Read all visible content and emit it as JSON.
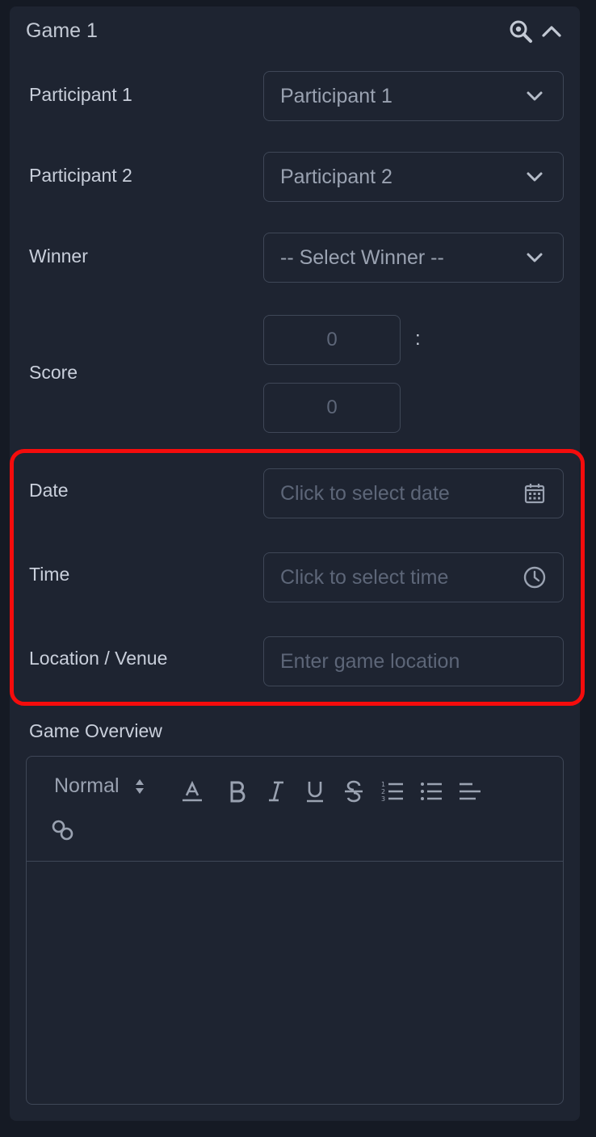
{
  "game": {
    "title": "Game 1",
    "header_icons": [
      "zoom-in-icon",
      "chevron-up-icon"
    ]
  },
  "fields": {
    "participant1": {
      "label": "Participant 1",
      "value": "Participant 1"
    },
    "participant2": {
      "label": "Participant 2",
      "value": "Participant 2"
    },
    "winner": {
      "label": "Winner",
      "value": "-- Select Winner --"
    },
    "score": {
      "label": "Score",
      "value1": "0",
      "value2": "0",
      "separator": ":"
    },
    "date": {
      "label": "Date",
      "placeholder": "Click to select date"
    },
    "time": {
      "label": "Time",
      "placeholder": "Click to select time"
    },
    "location": {
      "label": "Location / Venue",
      "placeholder": "Enter game location"
    }
  },
  "overview": {
    "label": "Game Overview",
    "format_select": "Normal",
    "toolbar_icons": [
      "text-color-icon",
      "bold-icon",
      "italic-icon",
      "underline-icon",
      "strikethrough-icon",
      "ordered-list-icon",
      "bullet-list-icon",
      "align-icon",
      "link-icon"
    ]
  },
  "colors": {
    "background": "#151a24",
    "card": "#1e2431",
    "border": "#3f4757",
    "highlight": "#f50c0c"
  }
}
